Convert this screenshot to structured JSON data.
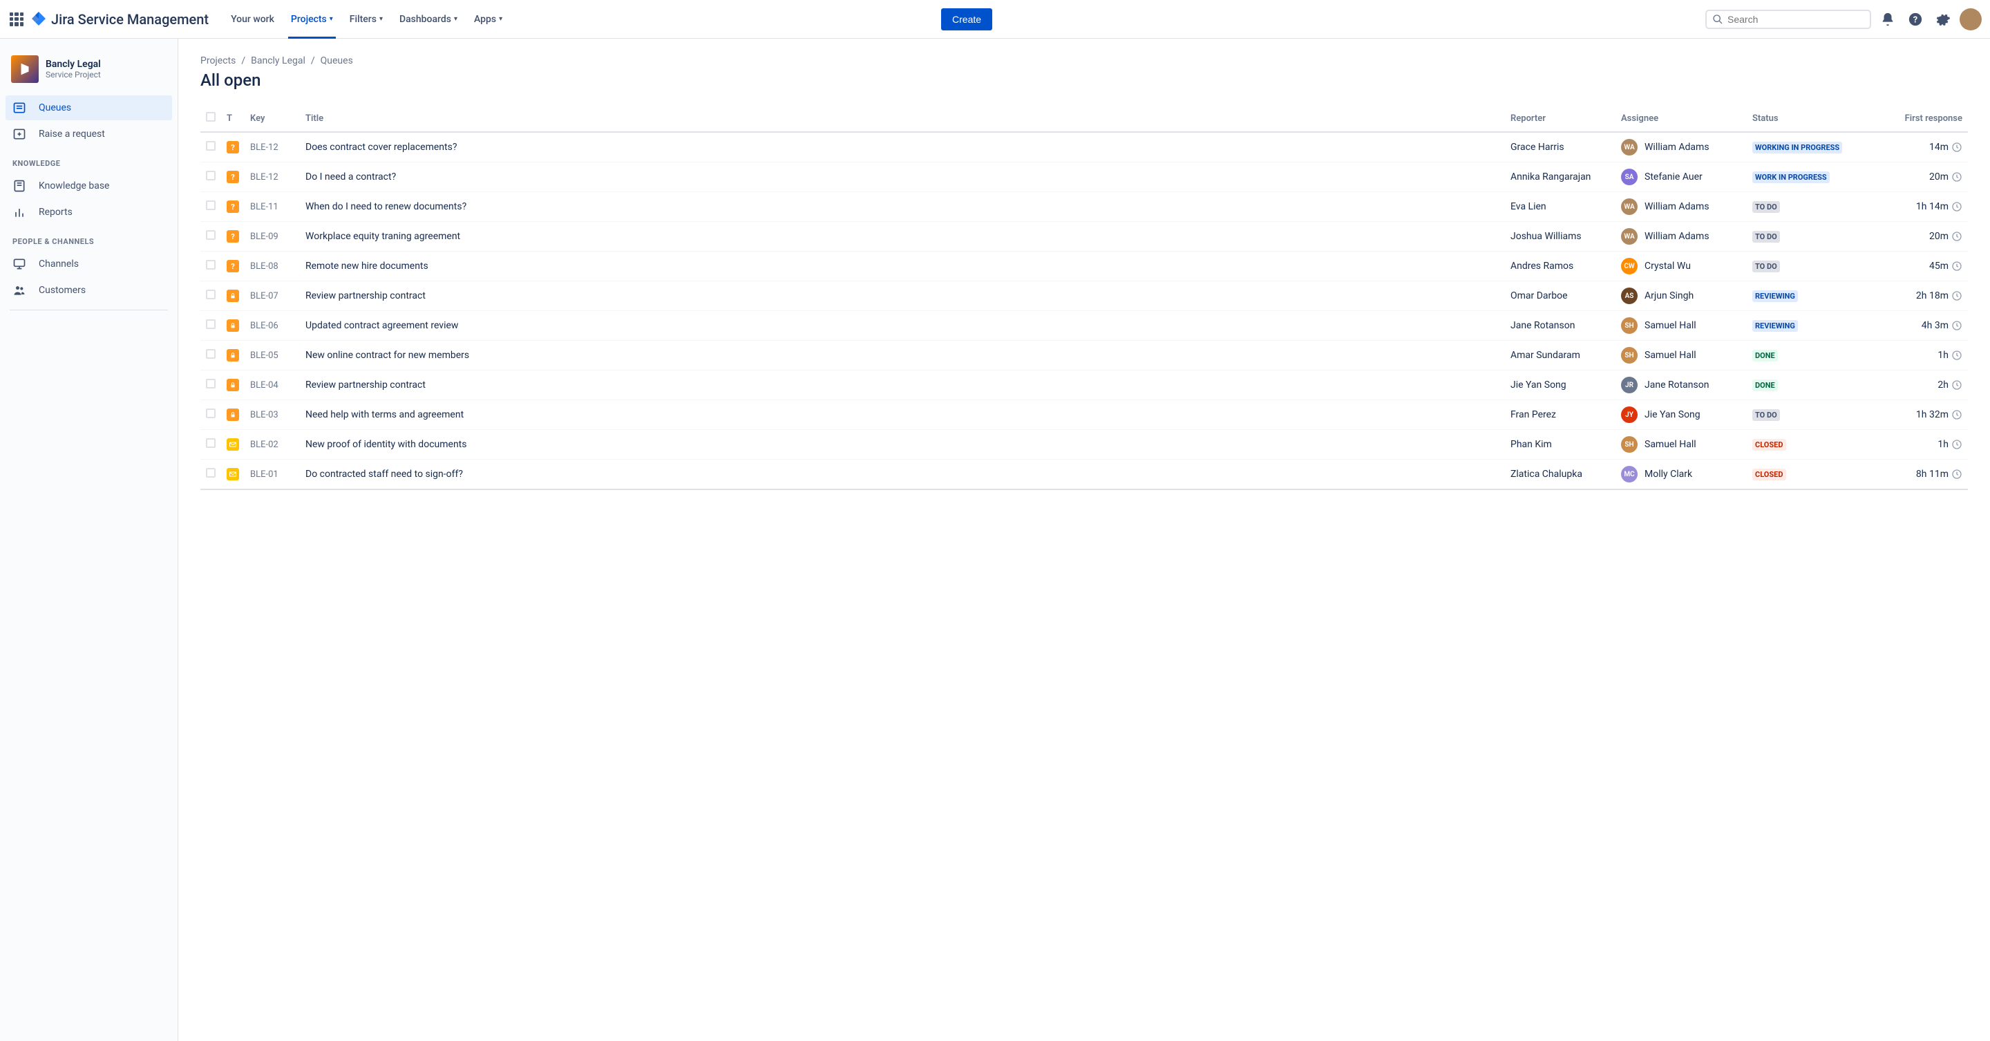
{
  "header": {
    "product": "Jira Service Management",
    "nav": [
      {
        "label": "Your work",
        "dropdown": false
      },
      {
        "label": "Projects",
        "dropdown": true,
        "active": true
      },
      {
        "label": "Filters",
        "dropdown": true
      },
      {
        "label": "Dashboards",
        "dropdown": true
      },
      {
        "label": "Apps",
        "dropdown": true
      }
    ],
    "create": "Create",
    "search_placeholder": "Search"
  },
  "sidebar": {
    "project": {
      "name": "Bancly Legal",
      "subtitle": "Service Project"
    },
    "items_primary": [
      {
        "label": "Queues",
        "icon": "queue",
        "active": true
      },
      {
        "label": "Raise a request",
        "icon": "plus-box"
      }
    ],
    "section_knowledge": "KNOWLEDGE",
    "items_knowledge": [
      {
        "label": "Knowledge base",
        "icon": "book"
      },
      {
        "label": "Reports",
        "icon": "bar-chart"
      }
    ],
    "section_people": "PEOPLE & CHANNELS",
    "items_people": [
      {
        "label": "Channels",
        "icon": "screen"
      },
      {
        "label": "Customers",
        "icon": "people"
      }
    ]
  },
  "breadcrumbs": [
    "Projects",
    "Bancly Legal",
    "Queues"
  ],
  "page_title": "All open",
  "columns": {
    "t": "T",
    "key": "Key",
    "title": "Title",
    "reporter": "Reporter",
    "assignee": "Assignee",
    "status": "Status",
    "first_response": "First response"
  },
  "rows": [
    {
      "type": "q",
      "key": "BLE-12",
      "title": "Does contract cover replacements?",
      "reporter": "Grace Harris",
      "assignee": "William Adams",
      "ac": "#b08860",
      "status": "WORKING IN PROGRESS",
      "st": "progress",
      "resp": "14m"
    },
    {
      "type": "q",
      "key": "BLE-12",
      "title": "Do I need a contract?",
      "reporter": "Annika Rangarajan",
      "assignee": "Stefanie Auer",
      "ac": "#8270DB",
      "status": "WORK IN PROGRESS",
      "st": "progress",
      "resp": "20m"
    },
    {
      "type": "q",
      "key": "BLE-11",
      "title": "When do I need to renew documents?",
      "reporter": "Eva Lien",
      "assignee": "William Adams",
      "ac": "#b08860",
      "status": "TO DO",
      "st": "todo",
      "resp": "1h 14m"
    },
    {
      "type": "q",
      "key": "BLE-09",
      "title": "Workplace equity traning agreement",
      "reporter": "Joshua Williams",
      "assignee": "William Adams",
      "ac": "#b08860",
      "status": "TO DO",
      "st": "todo",
      "resp": "20m"
    },
    {
      "type": "q",
      "key": "BLE-08",
      "title": "Remote new hire documents",
      "reporter": "Andres Ramos",
      "assignee": "Crystal Wu",
      "ac": "#FF8B00",
      "status": "TO DO",
      "st": "todo",
      "resp": "45m"
    },
    {
      "type": "l",
      "key": "BLE-07",
      "title": "Review partnership contract",
      "reporter": "Omar Darboe",
      "assignee": "Arjun Singh",
      "ac": "#6B4423",
      "status": "REVIEWING",
      "st": "review",
      "resp": "2h 18m"
    },
    {
      "type": "l",
      "key": "BLE-06",
      "title": "Updated contract agreement review",
      "reporter": "Jane Rotanson",
      "assignee": "Samuel Hall",
      "ac": "#c88b4a",
      "status": "REVIEWING",
      "st": "review",
      "resp": "4h 3m"
    },
    {
      "type": "l",
      "key": "BLE-05",
      "title": "New online contract for new members",
      "reporter": "Amar Sundaram",
      "assignee": "Samuel Hall",
      "ac": "#c88b4a",
      "status": "DONE",
      "st": "done",
      "resp": "1h"
    },
    {
      "type": "l",
      "key": "BLE-04",
      "title": "Review partnership contract",
      "reporter": "Jie Yan Song",
      "assignee": "Jane Rotanson",
      "ac": "#6B778C",
      "status": "DONE",
      "st": "done",
      "resp": "2h"
    },
    {
      "type": "l",
      "key": "BLE-03",
      "title": "Need help with terms and agreement",
      "reporter": "Fran Perez",
      "assignee": "Jie Yan Song",
      "ac": "#DE350B",
      "status": "TO DO",
      "st": "todo",
      "resp": "1h 32m"
    },
    {
      "type": "e",
      "key": "BLE-02",
      "title": "New proof of identity with documents",
      "reporter": "Phan Kim",
      "assignee": "Samuel Hall",
      "ac": "#c88b4a",
      "status": "CLOSED",
      "st": "closed",
      "resp": "1h"
    },
    {
      "type": "e",
      "key": "BLE-01",
      "title": "Do contracted staff need to sign-off?",
      "reporter": "Zlatica Chalupka",
      "assignee": "Molly Clark",
      "ac": "#998DD9",
      "status": "CLOSED",
      "st": "closed",
      "resp": "8h 11m"
    }
  ]
}
